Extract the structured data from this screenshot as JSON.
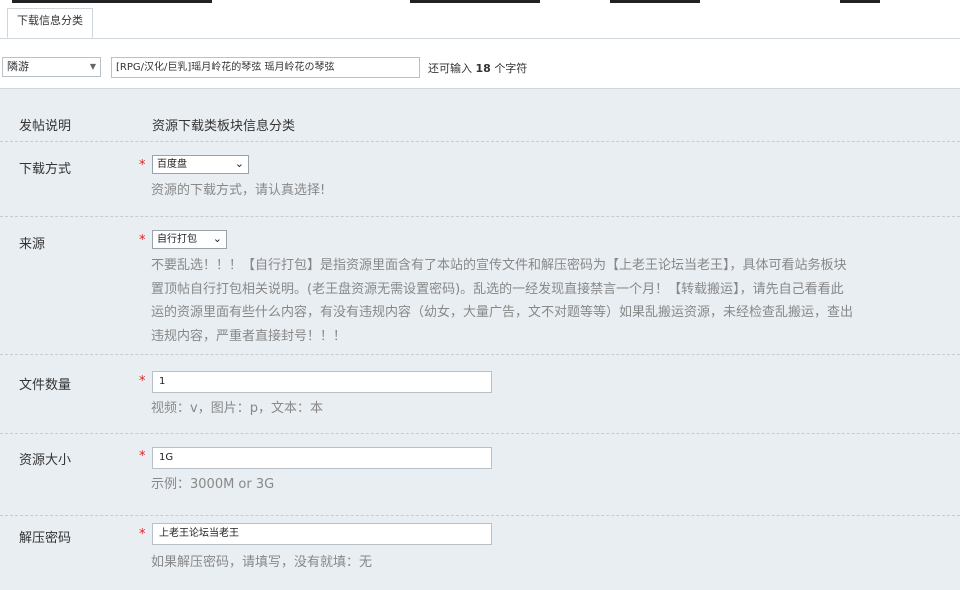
{
  "tabs": [
    {
      "label": "下载信息分类"
    }
  ],
  "subject": {
    "type_value": "隣游",
    "title_value": "[RPG/汉化/巨乳]瑶月岭花的琴弦 瑶月岭花の琴弦",
    "remain_prefix": "还可输入",
    "remain_count": "18",
    "remain_suffix": "个字符"
  },
  "form": {
    "post_desc": {
      "label": "发帖说明",
      "value": "资源下载类板块信息分类"
    },
    "download": {
      "label": "下载方式",
      "selected": "百度盘",
      "hint": "资源的下载方式，请认真选择!"
    },
    "source": {
      "label": "来源",
      "selected": "自行打包",
      "hint_lines": [
        "不要乱选！！！【自行打包】是指资源里面含有了本站的宣传文件和解压密码为【上老王论坛当老王】，具体可看站务板块",
        "置顶帖自行打包相关说明。(老王盘资源无需设置密码)。乱选的一经发现直接禁言一个月！【转载搬运】，请先自己看看此",
        "运的资源里面有些什么内容，有没有违规内容（幼女，大量广告，文不对题等等）如果乱搬运资源，未经检查乱搬运，查出",
        "违规内容，严重者直接封号！！！"
      ]
    },
    "file_count": {
      "label": "文件数量",
      "value": "1",
      "hint": "视频：v，图片：p，文本：本"
    },
    "size": {
      "label": "资源大小",
      "value": "1G",
      "hint": "示例：3000M or 3G"
    },
    "password": {
      "label": "解压密码",
      "value": "上老王论坛当老王",
      "hint": "如果解压密码，请填写，没有就填：无"
    }
  }
}
